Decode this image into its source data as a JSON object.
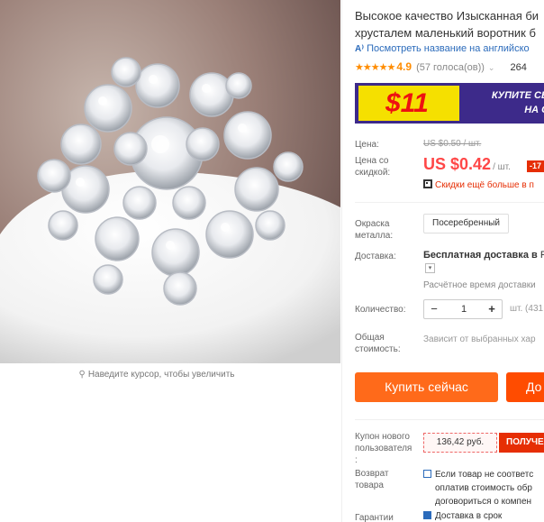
{
  "product": {
    "title_line1": "Высокое качество Изысканная би",
    "title_line2": "хрусталем маленький воротник б",
    "translate_link": "Посмотреть название на английско",
    "rating": {
      "stars": "★★★★★",
      "score": "4.9",
      "votes": "(57 голоса(ов))",
      "orders": "264"
    }
  },
  "gallery": {
    "zoom_hint": "Наведите курсор, чтобы увеличить"
  },
  "banner": {
    "amount": "$11",
    "line1": "КУПИТЕ СЕЙЧ",
    "line2": "НА СЛЕ"
  },
  "pricing": {
    "price_label": "Цена:",
    "old_price": "US $0.50 / шт.",
    "discount_label_line1": "Цена со",
    "discount_label_line2": "скидкой:",
    "price": "US $0.42",
    "unit": "/ шт.",
    "discount_tag": "-17",
    "bulk_discount": "Скидки ещё больше в п"
  },
  "options": {
    "color_label_line1": "Окраска",
    "color_label_line2": "металла:",
    "color_value": "Посеребренный",
    "shipping_label": "Доставка:",
    "shipping_bold": "Бесплатная доставка в",
    "shipping_rest": " R",
    "shipping_time": "Расчётное время доставки",
    "quantity_label": "Количество:",
    "quantity_minus": "−",
    "quantity_value": "1",
    "quantity_plus": "+",
    "quantity_note": "шт. (431",
    "total_label_line1": "Общая",
    "total_label_line2": "стоимость:",
    "total_note": "Зависит от выбранных хар"
  },
  "actions": {
    "buy_now": "Купить сейчас",
    "add_to_cart": "До"
  },
  "coupon": {
    "label_line1": "Купон нового",
    "label_line2": "пользователя",
    "label_line3": ":",
    "amount": "136,42 руб.",
    "button": "ПОЛУЧЕ"
  },
  "returns": {
    "label_line1": "Возврат",
    "label_line2": "товара",
    "text_line1": "Если товар не соответс",
    "text_line2": "оплатив стоимость обр",
    "text_line3": "договориться о компен"
  },
  "guarantee": {
    "label": "Гарантии",
    "text": "Доставка в срок"
  },
  "colors": {
    "accent_orange": "#ff6a1a",
    "price_red": "#ff4747",
    "link_blue": "#2b6bbb",
    "banner_purple": "#3d2a8a",
    "banner_yellow": "#f5e000"
  }
}
